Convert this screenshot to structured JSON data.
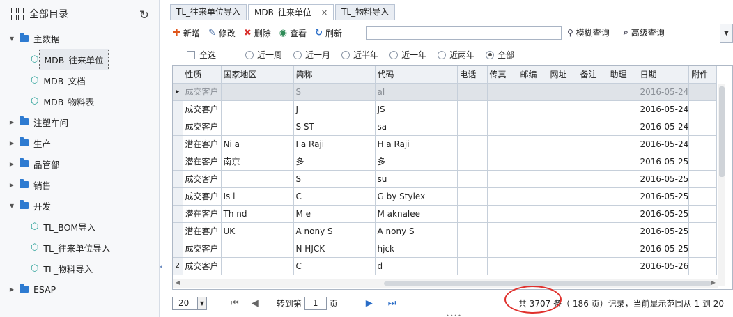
{
  "sidebar": {
    "title": "全部目录",
    "items": [
      {
        "label": "主数据",
        "type": "group",
        "expanded": true
      },
      {
        "label": "MDB_往来单位",
        "type": "leaf",
        "selected": true
      },
      {
        "label": "MDB_文档",
        "type": "leaf"
      },
      {
        "label": "MDB_物料表",
        "type": "leaf"
      },
      {
        "label": "注塑车间",
        "type": "group",
        "expanded": false
      },
      {
        "label": "生产",
        "type": "group",
        "expanded": false
      },
      {
        "label": "品管部",
        "type": "group",
        "expanded": false
      },
      {
        "label": "销售",
        "type": "group",
        "expanded": false
      },
      {
        "label": "开发",
        "type": "group",
        "expanded": true
      },
      {
        "label": "TL_BOM导入",
        "type": "leaf"
      },
      {
        "label": "TL_往来单位导入",
        "type": "leaf"
      },
      {
        "label": "TL_物料导入",
        "type": "leaf"
      },
      {
        "label": "ESAP",
        "type": "group",
        "expanded": false
      }
    ]
  },
  "tabs": [
    {
      "label": "TL_往来单位导入",
      "active": false
    },
    {
      "label": "MDB_往来单位",
      "active": true,
      "close": "✕"
    },
    {
      "label": "TL_物料导入",
      "active": false
    }
  ],
  "toolbar": {
    "add": "新增",
    "edit": "修改",
    "delete": "删除",
    "view": "查看",
    "refresh": "刷新",
    "search_value": "",
    "fuzzy": "模糊查询",
    "advanced": "高级查询"
  },
  "filters": {
    "select_all": "全选",
    "ranges": [
      "近一周",
      "近一月",
      "近半年",
      "近一年",
      "近两年",
      "全部"
    ],
    "selected": "全部"
  },
  "table": {
    "columns": [
      "性质",
      "国家地区",
      "简称",
      "代码",
      "电话",
      "传真",
      "邮编",
      "网址",
      "备注",
      "助理",
      "日期",
      "附件"
    ],
    "rows": [
      {
        "marker": "▸",
        "cells": [
          "成交客户",
          "",
          "S",
          "al",
          "",
          "",
          "",
          "",
          "",
          "",
          "2016-05-24",
          ""
        ]
      },
      {
        "marker": "",
        "cells": [
          "成交客户",
          "",
          "J",
          "JS",
          "",
          "",
          "",
          "",
          "",
          "",
          "2016-05-24",
          ""
        ]
      },
      {
        "marker": "",
        "cells": [
          "成交客户",
          "",
          "S     ST",
          "sa",
          "",
          "",
          "",
          "",
          "",
          "",
          "2016-05-24",
          ""
        ]
      },
      {
        "marker": "",
        "cells": [
          "潜在客户",
          "Ni      a",
          "I      a Raji",
          "H     a Raji",
          "",
          "",
          "",
          "",
          "",
          "",
          "2016-05-24",
          ""
        ]
      },
      {
        "marker": "",
        "cells": [
          "潜在客户",
          "南京",
          "        多",
          "        多",
          "",
          "",
          "",
          "",
          "",
          "",
          "2016-05-25",
          ""
        ]
      },
      {
        "marker": "",
        "cells": [
          "成交客户",
          "",
          "S",
          "su",
          "",
          "",
          "",
          "",
          "",
          "",
          "2016-05-25",
          ""
        ]
      },
      {
        "marker": "",
        "cells": [
          "成交客户",
          "Is    l",
          "C",
          "G        by Stylex",
          "",
          "",
          "",
          "",
          "",
          "",
          "2016-05-25",
          ""
        ]
      },
      {
        "marker": "",
        "cells": [
          "潜在客户",
          "Th      nd",
          "M                  e",
          "M         aknalee",
          "",
          "",
          "",
          "",
          "",
          "",
          "2016-05-25",
          ""
        ]
      },
      {
        "marker": "",
        "cells": [
          "潜在客户",
          "UK",
          "A      nony S",
          "A     nony S",
          "",
          "",
          "",
          "",
          "",
          "",
          "2016-05-25",
          ""
        ]
      },
      {
        "marker": "",
        "cells": [
          "成交客户",
          "",
          "N      HJCK",
          "      hjck",
          "",
          "",
          "",
          "",
          "",
          "",
          "2016-05-25",
          ""
        ]
      },
      {
        "marker": "2",
        "cells": [
          "成交客户",
          "",
          "C",
          "d",
          "",
          "",
          "",
          "",
          "",
          "",
          "2016-05-26",
          ""
        ]
      }
    ]
  },
  "pager": {
    "page_size": "20",
    "goto_label": "转到第",
    "page": "1",
    "page_unit": "页",
    "total": "共 3707 条",
    "pages": "（ 186 页）记录，当前显示范围从 1 到 20"
  },
  "colors": {
    "accent": "#2e7bd1",
    "highlight_circle": "#e0302c"
  }
}
